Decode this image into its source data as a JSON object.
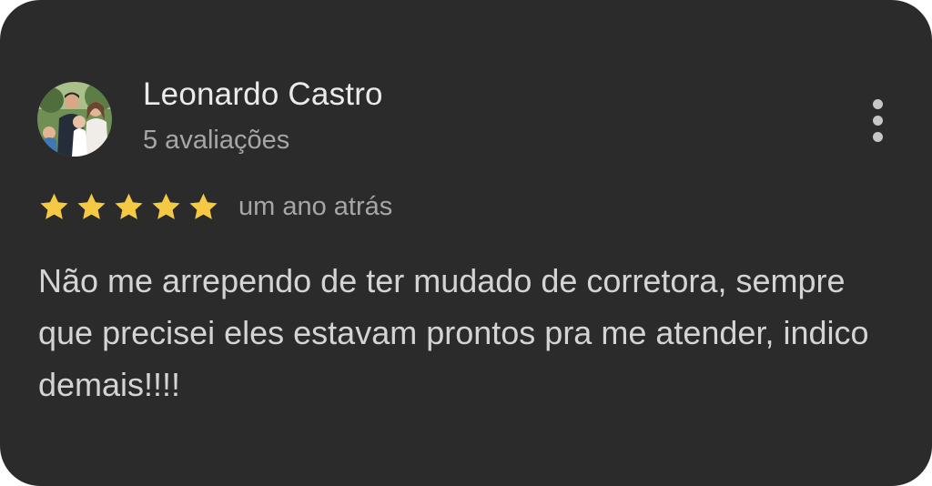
{
  "review": {
    "reviewer_name": "Leonardo Castro",
    "review_count": "5 avaliações",
    "rating": 5,
    "rating_max": 5,
    "date": "um ano atrás",
    "text": "Não me arrependo de ter mudado de corretora, sempre que precisei eles estavam prontos pra me atender, indico demais!!!!"
  },
  "icons": {
    "star": "star-icon",
    "more": "more-vert-icon"
  },
  "colors": {
    "background": "#2b2b2b",
    "star": "#f6c945",
    "name_text": "#ebebeb",
    "secondary_text": "#a6a6a6",
    "body_text": "#d4d4d4"
  }
}
